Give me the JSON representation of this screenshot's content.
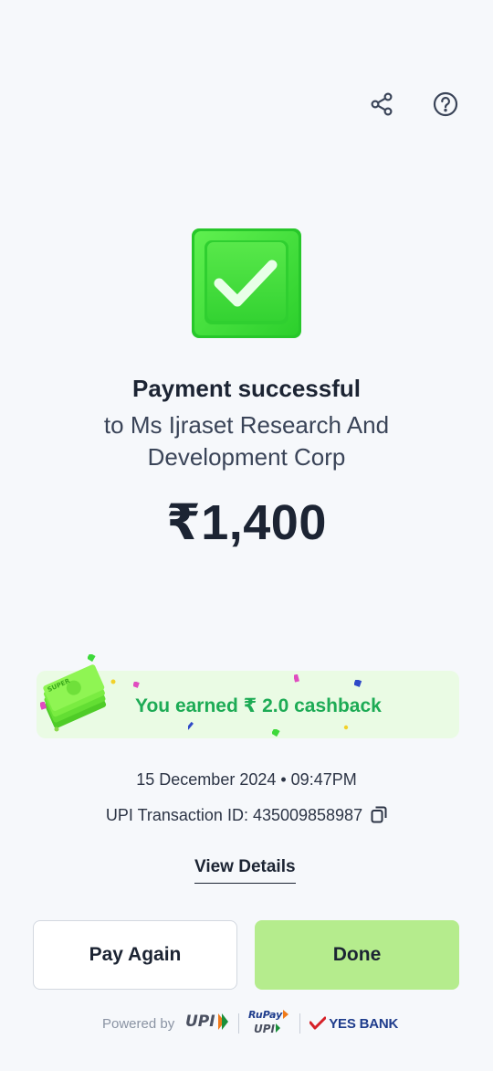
{
  "header": {
    "share_icon": "share-icon",
    "help_icon": "help-circle-icon"
  },
  "status": {
    "title": "Payment successful",
    "payee": "to Ms Ijraset Research And Development Corp",
    "amount": "₹1,400"
  },
  "cashback": {
    "text": "You earned ₹ 2.0 cashback",
    "image_label": "SUPER"
  },
  "transaction": {
    "datetime": "15 December 2024 • 09:47PM",
    "upi_id": "UPI Transaction ID: 435009858987"
  },
  "links": {
    "view_details": "View Details"
  },
  "actions": {
    "pay_again": "Pay Again",
    "done": "Done"
  },
  "footer": {
    "powered_by": "Powered by",
    "upi": "UPI",
    "rupay": "RuPay",
    "rupay_upi": "UPI",
    "bank": "YES BANK"
  },
  "colors": {
    "background": "#f6f8fb",
    "success_green": "#3ed93a",
    "cashback_bg": "#eafbe4",
    "cashback_text": "#1dab55",
    "done_button": "#b5ec8d"
  }
}
